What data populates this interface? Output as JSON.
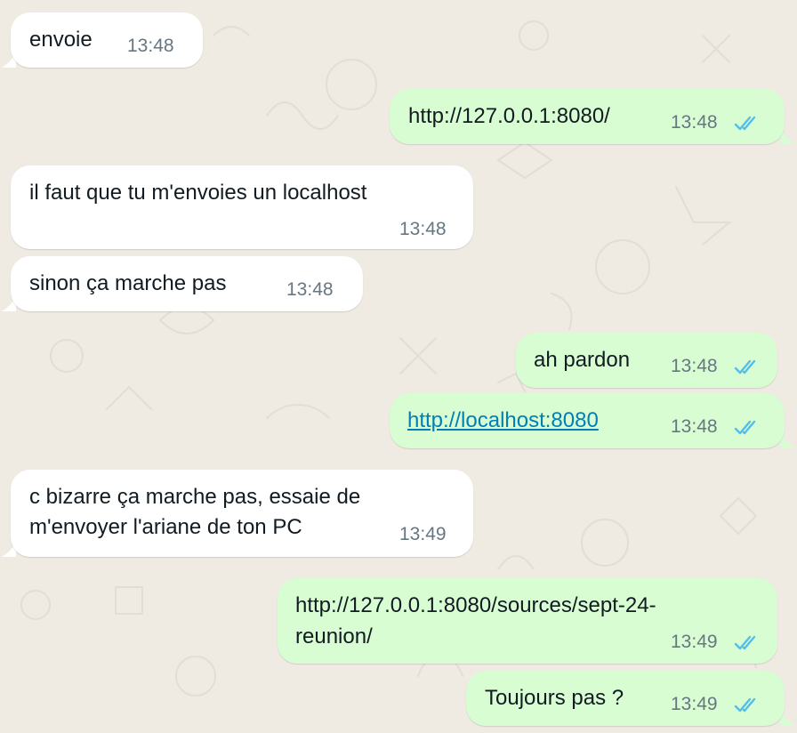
{
  "colors": {
    "background": "#efeae2",
    "incoming_bubble": "#ffffff",
    "outgoing_bubble": "#d9fdd3",
    "timestamp": "#667781",
    "read_ticks": "#53bdeb",
    "link": "#027eb5"
  },
  "messages": [
    {
      "direction": "incoming",
      "text": "envoie",
      "time": "13:48"
    },
    {
      "direction": "outgoing",
      "text": "http://127.0.0.1:8080/",
      "time": "13:48",
      "status": "read"
    },
    {
      "direction": "incoming",
      "text": "il faut que tu m'envoies un localhost",
      "time": "13:48"
    },
    {
      "direction": "incoming",
      "text": "sinon ça marche pas",
      "time": "13:48"
    },
    {
      "direction": "outgoing",
      "text": "ah pardon",
      "time": "13:48",
      "status": "read"
    },
    {
      "direction": "outgoing",
      "text": "http://localhost:8080",
      "time": "13:48",
      "status": "read",
      "is_link": true
    },
    {
      "direction": "incoming",
      "text_lines": [
        "c bizarre ça marche pas, essaie de",
        "m'envoyer l'ariane de ton PC"
      ],
      "time": "13:49"
    },
    {
      "direction": "outgoing",
      "text_lines": [
        "http://127.0.0.1:8080/sources/sept-24-",
        "reunion/"
      ],
      "time": "13:49",
      "status": "read"
    },
    {
      "direction": "outgoing",
      "text": "Toujours pas ?",
      "time": "13:49",
      "status": "read"
    }
  ]
}
